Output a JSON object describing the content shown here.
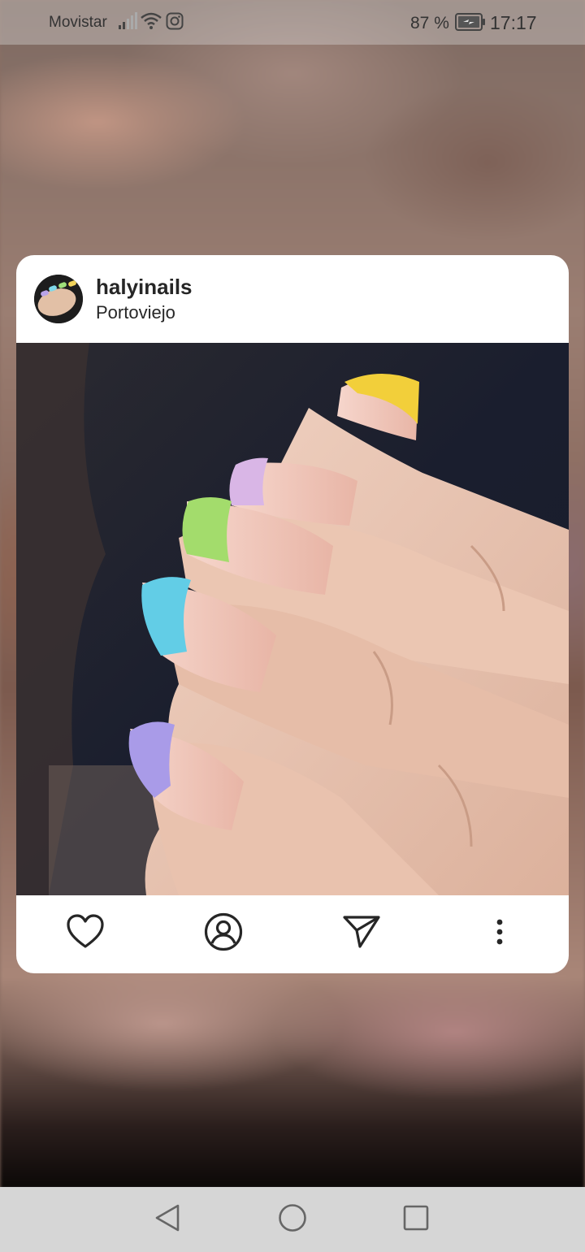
{
  "status_bar": {
    "carrier": "Movistar",
    "battery_percent": "87 %",
    "time": "17:17"
  },
  "post": {
    "username": "halyinails",
    "location": "Portoviejo",
    "image_subject": "nail-art-photo"
  },
  "actions": {
    "icons": [
      "heart-icon",
      "profile-icon",
      "send-icon",
      "more-vertical-icon"
    ]
  },
  "navigation": {
    "icons": [
      "back-icon",
      "home-icon",
      "recents-icon"
    ]
  }
}
